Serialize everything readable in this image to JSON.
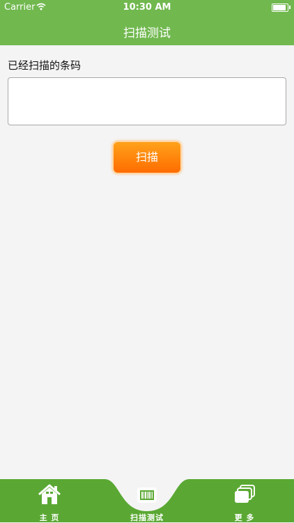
{
  "status_bar": {
    "carrier": "Carrier",
    "time": "10:30 AM"
  },
  "header": {
    "title": "扫描测试"
  },
  "main": {
    "scanned_label": "已经扫描的条码",
    "barcode_value": "",
    "scan_button_label": "扫描"
  },
  "tabbar": {
    "items": [
      {
        "label": "主 页",
        "icon": "home-icon"
      },
      {
        "label": "扫描测试",
        "icon": "barcode-icon"
      },
      {
        "label": "更 多",
        "icon": "more-icon"
      }
    ]
  },
  "colors": {
    "header_green": "#71b84f",
    "tabbar_green": "#5aa833",
    "button_orange_top": "#ffa21a",
    "button_orange_bottom": "#ff6c00"
  }
}
